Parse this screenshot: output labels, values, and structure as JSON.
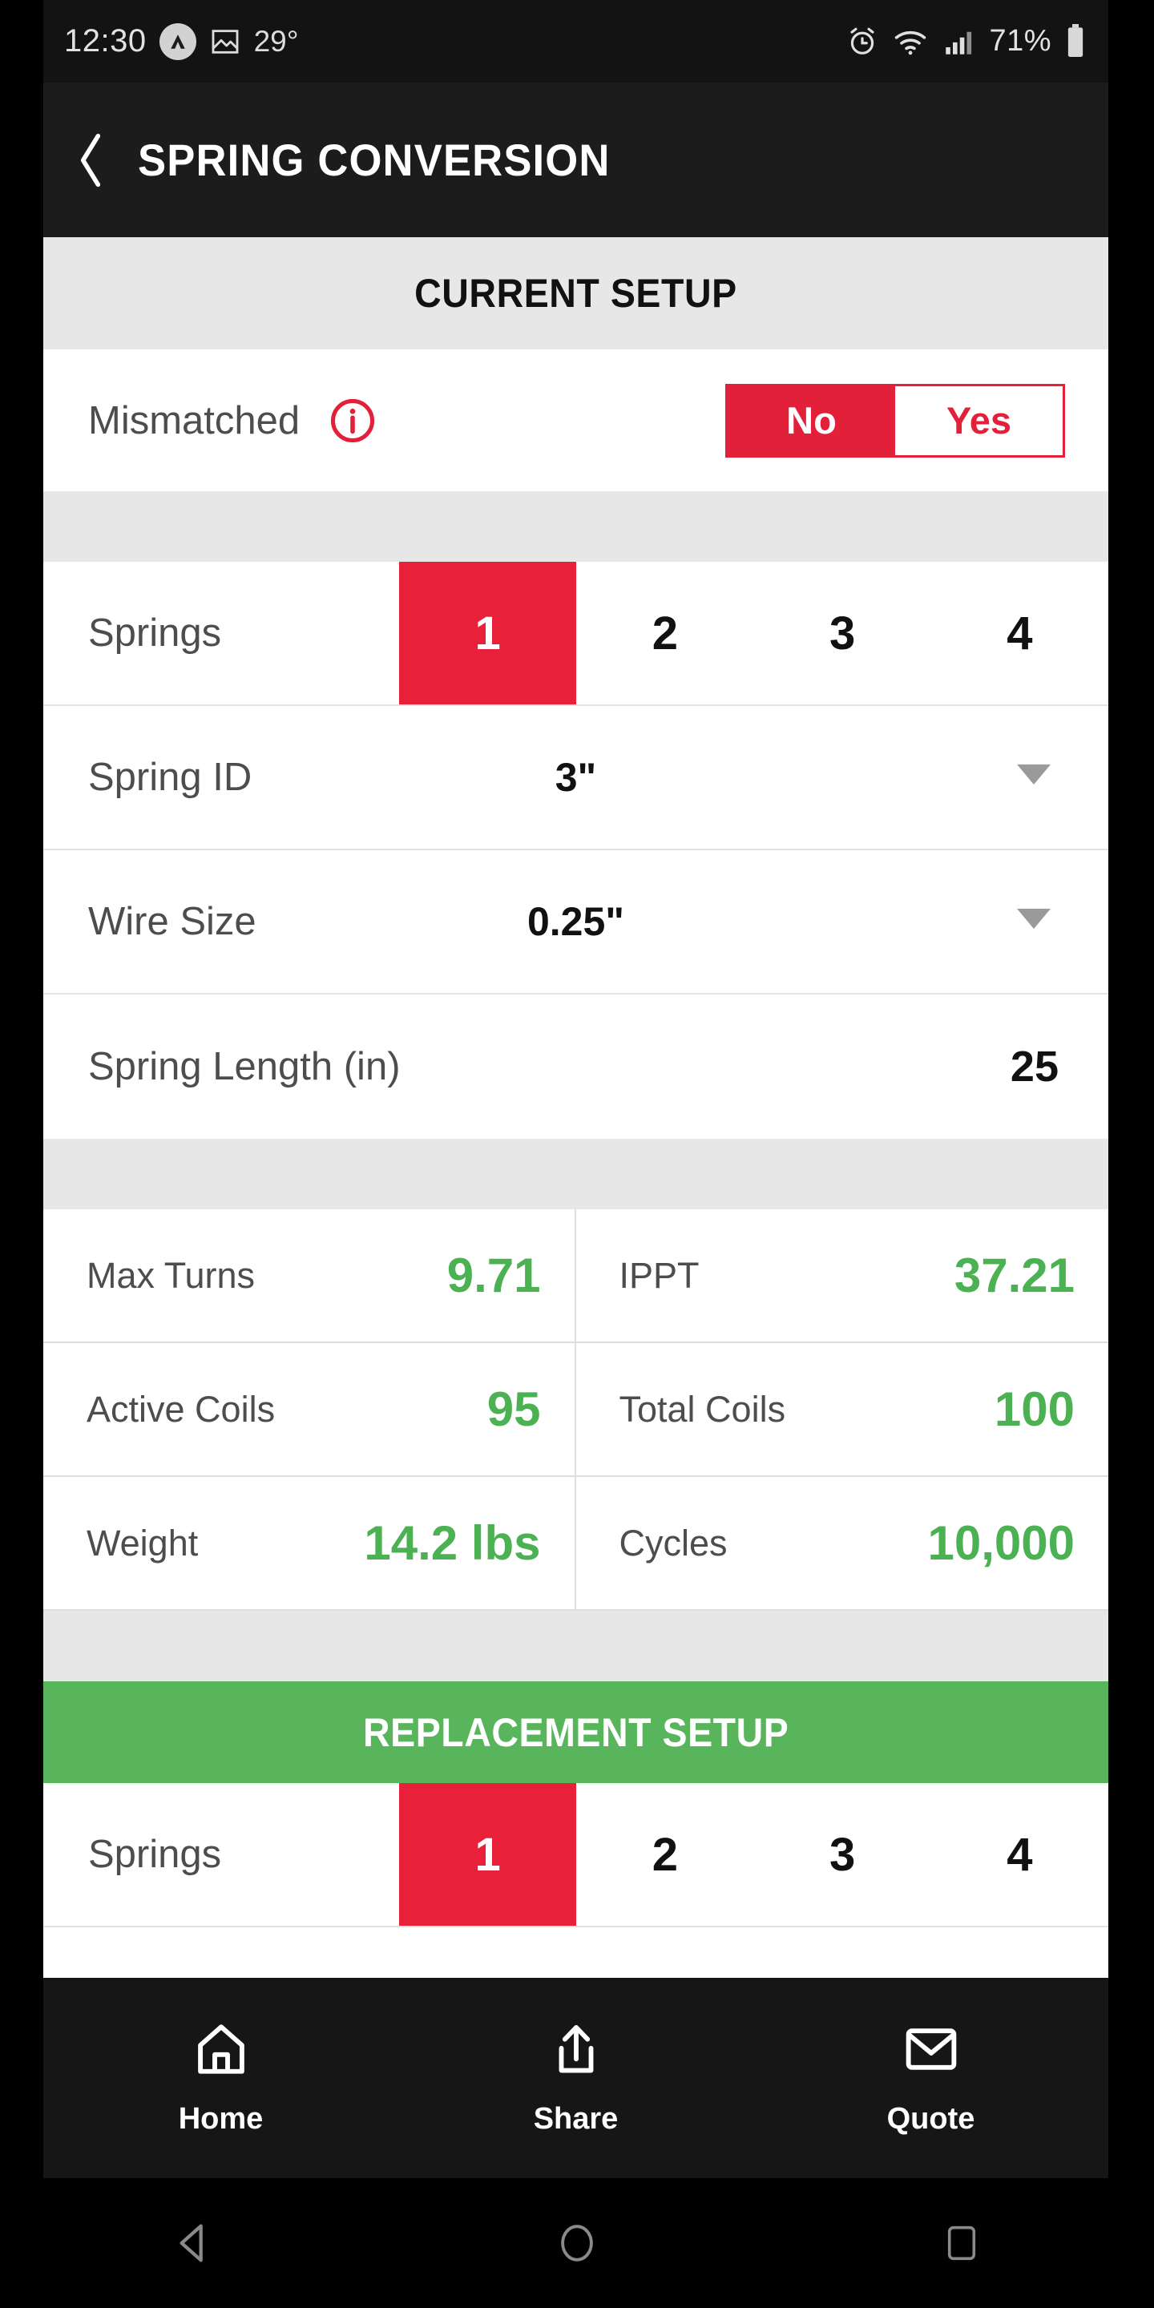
{
  "status_bar": {
    "time": "12:30",
    "temperature": "29°",
    "battery_percent": "71%",
    "icons": [
      "app-badge-icon",
      "image-icon",
      "alarm-icon",
      "wifi-icon",
      "signal-icon",
      "battery-icon"
    ]
  },
  "app_bar": {
    "back_label": "back-icon",
    "title": "SPRING CONVERSION"
  },
  "colors": {
    "accent_red": "#e8203a",
    "accent_green": "#59b55b",
    "value_green": "#4cb152",
    "header_gray": "#e7e7e7",
    "label_gray": "#4d4d4d"
  },
  "current_setup": {
    "header": "CURRENT SETUP",
    "mismatched": {
      "label": "Mismatched",
      "info_icon": "info-circle-icon",
      "options": [
        "No",
        "Yes"
      ],
      "selected": "No"
    },
    "springs": {
      "label": "Springs",
      "options": [
        "1",
        "2",
        "3",
        "4"
      ],
      "selected": "1"
    },
    "spring_id": {
      "label": "Spring ID",
      "value": "3\"",
      "caret": "chevron-down-icon"
    },
    "wire_size": {
      "label": "Wire Size",
      "value": "0.25\"",
      "caret": "chevron-down-icon"
    },
    "spring_length": {
      "label": "Spring Length (in)",
      "value": "25"
    },
    "results": [
      {
        "label": "Max Turns",
        "value": "9.71"
      },
      {
        "label": "IPPT",
        "value": "37.21"
      },
      {
        "label": "Active Coils",
        "value": "95"
      },
      {
        "label": "Total Coils",
        "value": "100"
      },
      {
        "label": "Weight",
        "value": "14.2 lbs"
      },
      {
        "label": "Cycles",
        "value": "10,000"
      }
    ]
  },
  "replacement_setup": {
    "header": "REPLACEMENT SETUP",
    "springs": {
      "label": "Springs",
      "options": [
        "1",
        "2",
        "3",
        "4"
      ],
      "selected": "1"
    }
  },
  "bottom_nav": [
    {
      "label": "Home",
      "icon": "home-icon"
    },
    {
      "label": "Share",
      "icon": "share-icon"
    },
    {
      "label": "Quote",
      "icon": "envelope-icon"
    }
  ],
  "system_nav": [
    {
      "name": "back-button"
    },
    {
      "name": "home-button"
    },
    {
      "name": "recents-button"
    }
  ]
}
